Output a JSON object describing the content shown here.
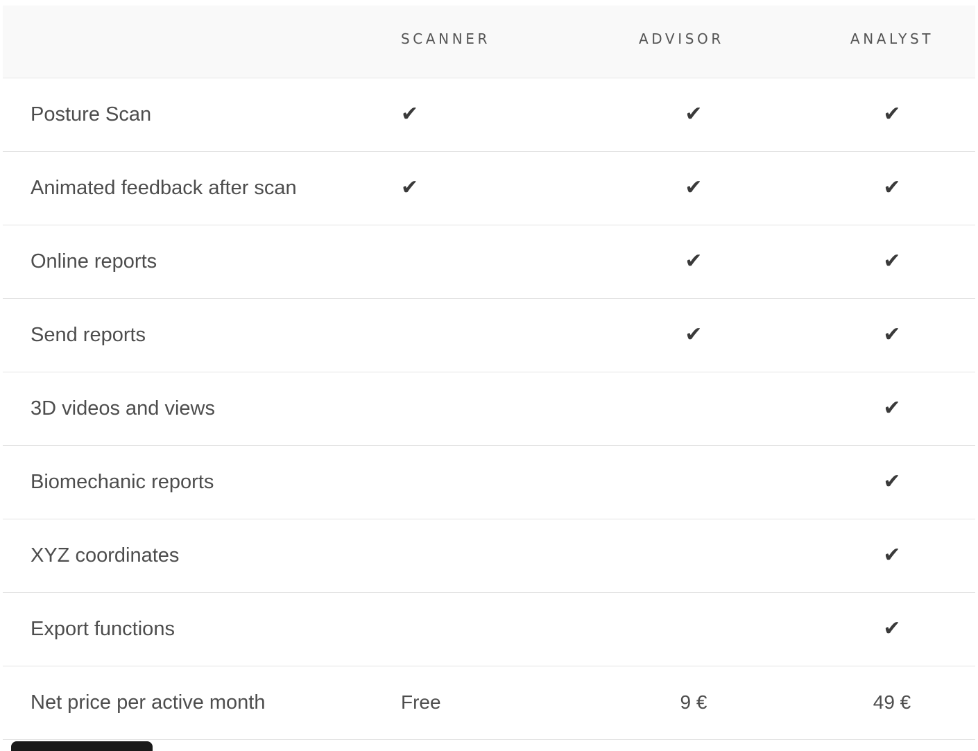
{
  "columns": {
    "scanner": "SCANNER",
    "advisor": "ADVISOR",
    "analyst": "ANALYST"
  },
  "check_glyph": "✔",
  "check_icon": "heavy-check-mark",
  "rows": [
    {
      "feature": "Posture Scan",
      "scanner": true,
      "advisor": true,
      "analyst": true
    },
    {
      "feature": "Animated feedback after scan",
      "scanner": true,
      "advisor": true,
      "analyst": true
    },
    {
      "feature": "Online reports",
      "scanner": false,
      "advisor": true,
      "analyst": true
    },
    {
      "feature": "Send reports",
      "scanner": false,
      "advisor": true,
      "analyst": true
    },
    {
      "feature": "3D videos and views",
      "scanner": false,
      "advisor": false,
      "analyst": true
    },
    {
      "feature": "Biomechanic reports",
      "scanner": false,
      "advisor": false,
      "analyst": true
    },
    {
      "feature": "XYZ coordinates",
      "scanner": false,
      "advisor": false,
      "analyst": true
    },
    {
      "feature": "Export functions",
      "scanner": false,
      "advisor": false,
      "analyst": true
    }
  ],
  "price_row": {
    "label": "Net price per active month",
    "scanner": "Free",
    "advisor": "9 €",
    "analyst": "49 €"
  },
  "colors": {
    "header_background": "#f9f9f9",
    "text": "#4d4d4d",
    "divider": "#e3e3e3"
  }
}
